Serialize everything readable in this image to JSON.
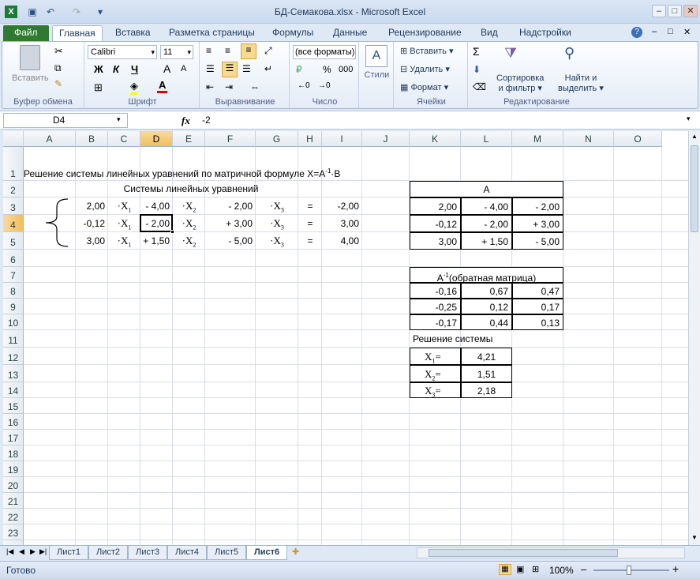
{
  "window": {
    "title": "БД-Семакова.xlsx - Microsoft Excel",
    "minimize": "–",
    "maximize": "□",
    "close": "✕",
    "doc_min": "–",
    "doc_restore": "□",
    "doc_close": "✕"
  },
  "tabs": [
    "Файл",
    "Главная",
    "Вставка",
    "Разметка страницы",
    "Формулы",
    "Данные",
    "Рецензирование",
    "Вид",
    "Надстройки"
  ],
  "ribbon": {
    "clipboard": {
      "label": "Буфер обмена",
      "paste": "Вставить"
    },
    "font": {
      "label": "Шрифт",
      "name": "Calibri",
      "size": "11",
      "bold": "Ж",
      "italic": "К",
      "underline": "Ч",
      "grow": "A",
      "shrink": "A",
      "color_letter": "A"
    },
    "align": {
      "label": "Выравнивание"
    },
    "number": {
      "label": "Число",
      "format": "(все форматы)",
      "percent": "%",
      "thousands": "000"
    },
    "styles": {
      "label": "Стили"
    },
    "cells": {
      "label": "Ячейки",
      "insert": "Вставить",
      "delete": "Удалить",
      "format": "Формат"
    },
    "editing": {
      "label": "Редактирование",
      "sigma": "Σ",
      "sort": "Сортировка",
      "sort2": "и фильтр",
      "find": "Найти и",
      "find2": "выделить"
    }
  },
  "formula_bar": {
    "name_box": "D4",
    "fx": "fx",
    "value": "-2"
  },
  "columns": [
    "A",
    "B",
    "C",
    "D",
    "E",
    "F",
    "G",
    "H",
    "I",
    "J",
    "K",
    "L",
    "M",
    "N",
    "O"
  ],
  "rows": [
    "1",
    "2",
    "3",
    "4",
    "5",
    "6",
    "7",
    "8",
    "9",
    "10",
    "11",
    "12",
    "13",
    "14",
    "15",
    "16",
    "17",
    "18",
    "19",
    "20",
    "21",
    "22",
    "23",
    "24"
  ],
  "sheet": {
    "title": "Решение системы линейных уравнений по матричной формуле X=A",
    "title_sup": "-1",
    "title_tail": "·B",
    "systems_caption": "Системы линейных уравнений",
    "equations": [
      {
        "a1": "2,00",
        "x1": "·X",
        "s1": "1",
        "a2": "- 4,00",
        "x2": "·X",
        "s2": "2",
        "a3": "- 2,00",
        "x3": "·X",
        "s3": "3",
        "eq": "=",
        "b": "-2,00"
      },
      {
        "a1": "-0,12",
        "x1": "·X",
        "s1": "1",
        "a2": "- 2,00",
        "x2": "·X",
        "s2": "2",
        "a3": "+ 3,00",
        "x3": "·X",
        "s3": "3",
        "eq": "=",
        "b": "3,00"
      },
      {
        "a1": "3,00",
        "x1": "·X",
        "s1": "1",
        "a2": "+ 1,50",
        "x2": "·X",
        "s2": "2",
        "a3": "- 5,00",
        "x3": "·X",
        "s3": "3",
        "eq": "=",
        "b": "4,00"
      }
    ],
    "matrixA": {
      "caption": "A",
      "rows": [
        [
          "2,00",
          "- 4,00",
          "- 2,00"
        ],
        [
          "-0,12",
          "- 2,00",
          "+ 3,00"
        ],
        [
          "3,00",
          "+ 1,50",
          "- 5,00"
        ]
      ]
    },
    "inverse": {
      "caption_a": "A",
      "caption_sup": "-1",
      "caption_tail": "(обратная матрица)",
      "rows": [
        [
          "-0,16",
          "0,67",
          "0,47"
        ],
        [
          "-0,25",
          "0,12",
          "0,17"
        ],
        [
          "-0,17",
          "0,44",
          "0,13"
        ]
      ]
    },
    "solution": {
      "caption": "Решение системы",
      "rows": [
        {
          "label": "X",
          "sub": "1",
          "eq": "=",
          "value": "4,21"
        },
        {
          "label": "X",
          "sub": "2",
          "eq": "=",
          "value": "1,51"
        },
        {
          "label": "X",
          "sub": "3",
          "eq": "=",
          "value": "2,18"
        }
      ]
    }
  },
  "sheets": [
    "Лист1",
    "Лист2",
    "Лист3",
    "Лист4",
    "Лист5",
    "Лист6"
  ],
  "active_sheet": "Лист6",
  "status": {
    "ready": "Готово",
    "zoom": "100%",
    "minus": "–",
    "plus": "+"
  }
}
